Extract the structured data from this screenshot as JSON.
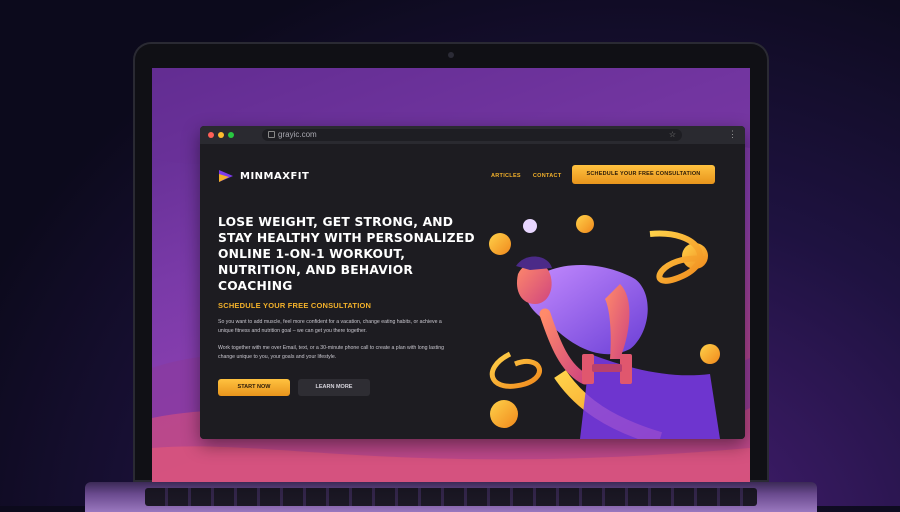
{
  "browser": {
    "url": "grayic.com",
    "icons": [
      "lock-icon",
      "star-icon",
      "menu-icon"
    ]
  },
  "site": {
    "brand": "MINMAXFIT",
    "nav": [
      "ARTICLES",
      "CONTACT"
    ],
    "cta_top": "SCHEDULE YOUR FREE CONSULTATION",
    "headline": "LOSE WEIGHT, GET STRONG, AND STAY HEALTHY WITH PERSONALIZED ONLINE 1-ON-1 WORKOUT, NUTRITION, AND BEHAVIOR COACHING",
    "subheading": "SCHEDULE YOUR FREE CONSULTATION",
    "paragraph1": "So you want to add muscle, feel more confident for a vacation, change eating habits, or achieve a unique fitness and nutrition goal – we can get you there together.",
    "paragraph2": "Work together with me over Email, text, or a 30-minute phone call to create a plan with long lasting change unique to you, your goals and your lifestyle.",
    "btn_start": "START NOW",
    "btn_more": "LEARN MORE"
  },
  "colors": {
    "accent": "#f3b12a",
    "background": "#1d1c21",
    "purple": "#7a3aa8"
  }
}
